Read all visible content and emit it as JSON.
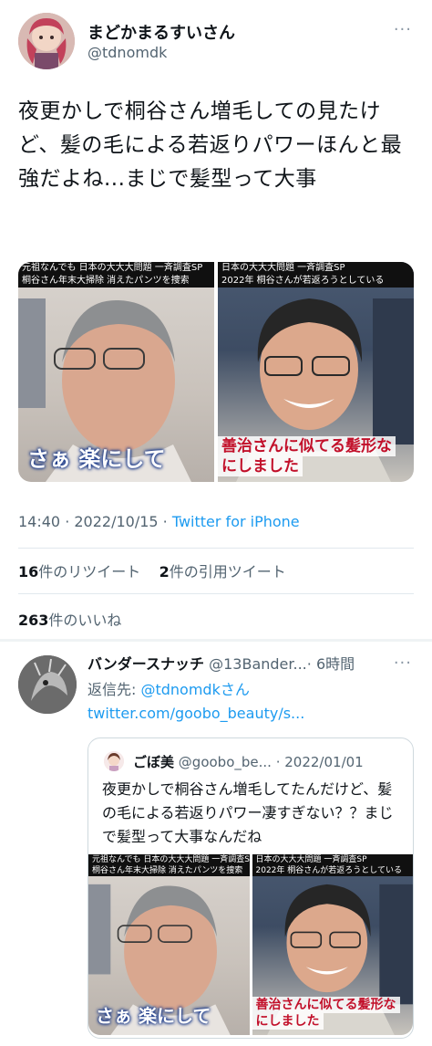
{
  "tweet": {
    "display_name": "まどかまるすいさん",
    "handle": "@tdnomdk",
    "more_icon": "more-dots-icon",
    "text": "夜更かしで桐谷さん増毛しての見たけど、髪の毛による若返りパワーほんと最強だよね...まじで髪型って大事",
    "media": {
      "left_banner_1": "元祖なんでも 日本の大大大問題 一斉調査SP",
      "left_banner_2": "桐谷さん年末大掃除 消えたパンツを捜索",
      "left_caption": "さぁ 楽にして",
      "right_banner_1": "日本の大大大問題 一斉調査SP",
      "right_banner_2": "2022年 桐谷さんが若返ろうとしている",
      "right_caption_1": "善治さんに似てる髪形な",
      "right_caption_2": "にしました"
    },
    "time": "14:40 · 2022/10/15 · ",
    "source": "Twitter for iPhone",
    "retweet_count": "16",
    "retweet_label": "件のリツイート",
    "quote_count": "2",
    "quote_label": "件の引用ツイート",
    "like_count": "263",
    "like_label": "件のいいね"
  },
  "reply": {
    "display_name": "バンダースナッチ",
    "handle": "@13Bander...",
    "time": "· 6時間",
    "more_icon": "more-dots-icon",
    "reply_to_label": "返信先: ",
    "reply_to_handle": "@tdnomdk",
    "reply_to_suffix": "さん",
    "link": "twitter.com/goobo_beauty/s...",
    "quote": {
      "display_name": "ごぼ美",
      "handle": "@goobo_be...",
      "time": "· 2022/01/01",
      "text": "夜更かしで桐谷さん増毛してたんだけど、髪の毛による若返りパワー凄すぎない？？まじで髪型って大事なんだね",
      "media": {
        "left_banner_1": "元祖なんでも 日本の大大大問題 一斉調査SP",
        "left_banner_2": "桐谷さん年末大掃除 消えたパンツを捜索",
        "left_caption": "さぁ 楽にして",
        "right_banner_1": "日本の大大大問題 一斉調査SP",
        "right_banner_2": "2022年 桐谷さんが若返ろうとしている",
        "right_caption_1": "善治さんに似てる髪形な",
        "right_caption_2": "にしました"
      }
    }
  }
}
